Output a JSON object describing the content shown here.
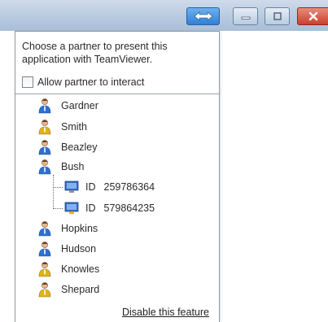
{
  "popup": {
    "prompt": "Choose a partner to present this application with TeamViewer.",
    "allow_label": "Allow partner to interact",
    "allow_checked": false,
    "disable_link": "Disable this feature"
  },
  "partners": [
    {
      "name": "Gardner",
      "icon": "user-icon",
      "status": "online"
    },
    {
      "name": "Smith",
      "icon": "user-icon",
      "status": "away"
    },
    {
      "name": "Beazley",
      "icon": "user-icon",
      "status": "online"
    },
    {
      "name": "Bush",
      "icon": "user-icon",
      "status": "online",
      "devices": [
        {
          "prefix": "ID",
          "id": "259786364",
          "icon": "computer-icon"
        },
        {
          "prefix": "ID",
          "id": "579864235",
          "icon": "computer-icon"
        }
      ]
    },
    {
      "name": "Hopkins",
      "icon": "user-icon",
      "status": "online"
    },
    {
      "name": "Hudson",
      "icon": "user-icon",
      "status": "online"
    },
    {
      "name": "Knowles",
      "icon": "user-icon",
      "status": "away"
    },
    {
      "name": "Shepard",
      "icon": "user-icon",
      "status": "away"
    }
  ],
  "colors": {
    "online": "#2f6fd0",
    "away": "#e0b020",
    "skin": "#e8b48a"
  }
}
